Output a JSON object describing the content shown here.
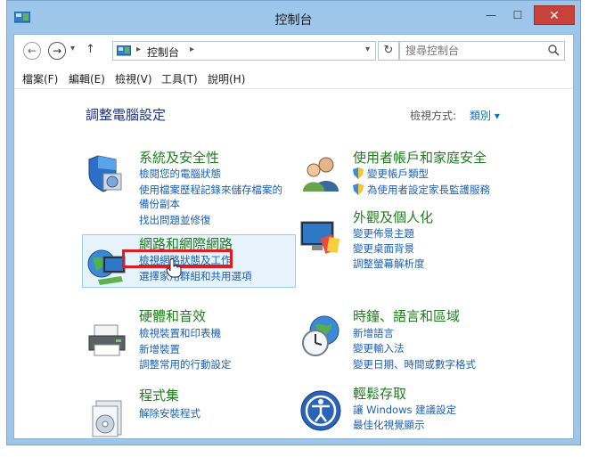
{
  "window": {
    "title": "控制台",
    "close": "✕",
    "minimize": "—",
    "maximize": "☐"
  },
  "nav": {
    "back": "←",
    "forward": "→",
    "dropdown": "▾",
    "up": "↑"
  },
  "address": {
    "crumb": "控制台",
    "sep": "▸",
    "dropdown": "▾"
  },
  "refresh": "↻",
  "search": {
    "placeholder": "搜尋控制台"
  },
  "menu": [
    "檔案(F)",
    "編輯(E)",
    "檢視(V)",
    "工具(T)",
    "說明(H)"
  ],
  "page": {
    "title": "調整電腦設定",
    "view_label": "檢視方式:",
    "view_value": "類別 ▾"
  },
  "categories": {
    "security": {
      "title": "系統及安全性",
      "links": [
        "檢閱您的電腦狀態",
        "使用檔案歷程記錄來儲存檔案的",
        "備份副本",
        "找出問題並修復"
      ]
    },
    "network": {
      "title": "網路和網際網路",
      "links": [
        "檢視網路狀態及工作",
        "選擇家用群組和共用選項"
      ]
    },
    "hardware": {
      "title": "硬體和音效",
      "links": [
        "檢視裝置和印表機",
        "新增裝置",
        "調整常用的行動設定"
      ]
    },
    "programs": {
      "title": "程式集",
      "links": [
        "解除安裝程式"
      ]
    },
    "users": {
      "title": "使用者帳戶和家庭安全",
      "links": [
        "變更帳戶類型",
        "為使用者設定家長監護服務"
      ]
    },
    "appearance": {
      "title": "外觀及個人化",
      "links": [
        "變更佈景主題",
        "變更桌面背景",
        "調整螢幕解析度"
      ]
    },
    "clock": {
      "title": "時鐘、語言和區域",
      "links": [
        "新增語言",
        "變更輸入法",
        "變更日期、時間或數字格式"
      ]
    },
    "ease": {
      "title": "輕鬆存取",
      "links": [
        "讓 Windows 建議設定",
        "最佳化視覺顯示"
      ]
    }
  },
  "colors": {
    "title_bar": "#9ec6ea",
    "close": "#c7423a",
    "link": "#1a5fb4",
    "category_title": "#1e7e1e",
    "highlight": "#e01d22"
  }
}
